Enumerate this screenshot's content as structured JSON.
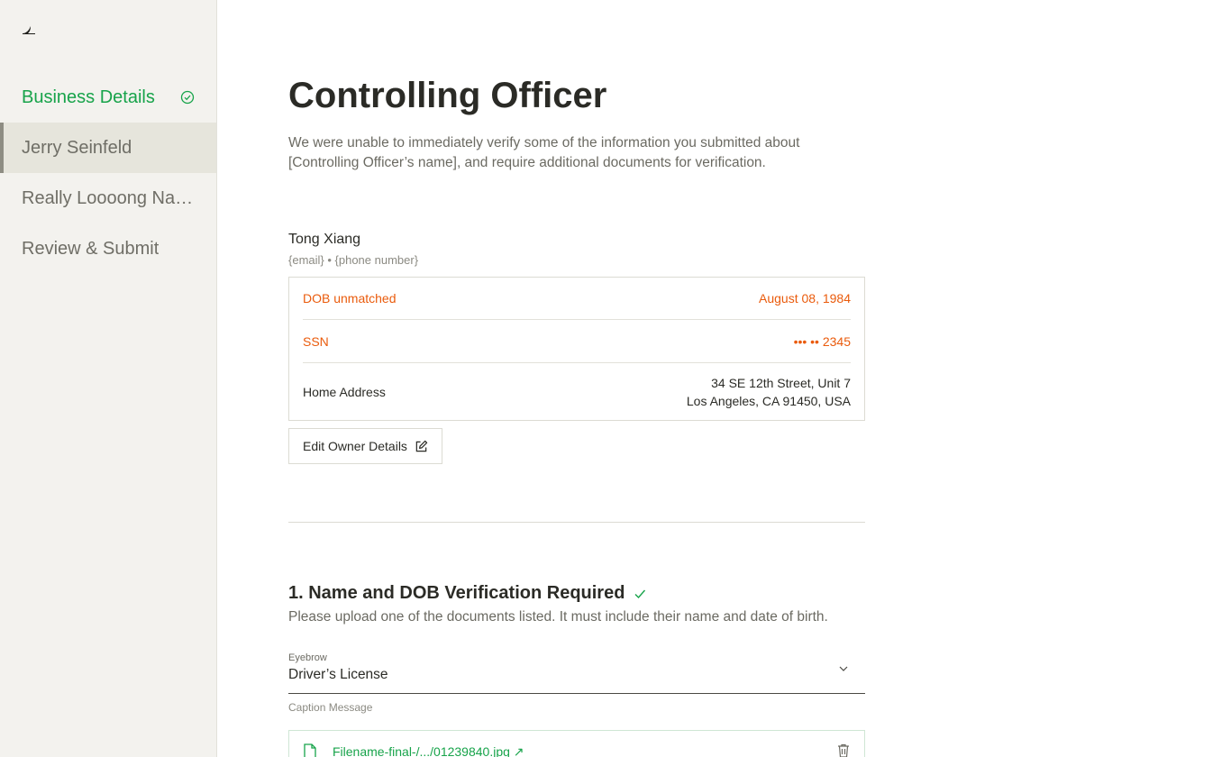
{
  "sidebar": {
    "logo_icon": "bird-logo-icon",
    "items": [
      {
        "label": "Business Details",
        "state": "done",
        "icon": "check-circle-icon"
      },
      {
        "label": "Jerry Seinfeld",
        "state": "active"
      },
      {
        "label": "Really Loooong Name",
        "state": "default"
      },
      {
        "label": "Review & Submit",
        "state": "default"
      }
    ]
  },
  "page": {
    "title": "Controlling Officer",
    "intro": "We were unable to immediately verify some of the information you submitted about [Controlling Officer’s name], and require additional documents for verification."
  },
  "owner": {
    "name": "Tong Xiang",
    "contact": "{email} • {phone number}",
    "rows": [
      {
        "label": "DOB unmatched",
        "value": "August 08, 1984",
        "status": "warning"
      },
      {
        "label": "SSN",
        "value": "••• •• 2345",
        "status": "warning"
      },
      {
        "label": "Home Address",
        "value_line1": "34 SE 12th Street, Unit 7",
        "value_line2": "Los Angeles, CA 91450, USA",
        "status": "normal"
      }
    ],
    "edit_button": "Edit Owner Details"
  },
  "section1": {
    "title": "1. Name and DOB Verification Required",
    "description": "Please upload one of the documents listed. It must include their name and date of birth.",
    "select": {
      "eyebrow": "Eyebrow",
      "value": "Driver’s License"
    },
    "caption": "Caption Message",
    "file": {
      "name": "Filename-final-/.../01239840.jpg ↗"
    }
  },
  "colors": {
    "success": "#17a34a",
    "warning": "#ea5b0c",
    "sidebar_bg": "#f3f2ee",
    "active_bg": "#e6e5dc"
  }
}
